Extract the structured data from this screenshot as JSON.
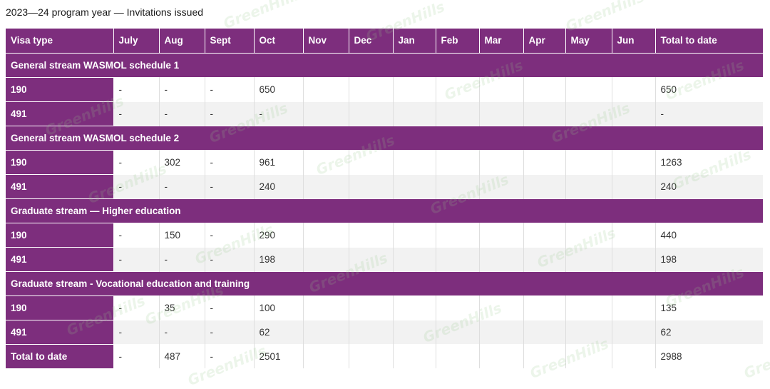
{
  "title": "2023—24 program year — Invitations issued",
  "watermark_text": "GreenHills",
  "colors": {
    "header_bg": "#7d2e7d",
    "header_text": "#ffffff",
    "row_alt_bg": "#f2f2f2",
    "row_bg": "#ffffff"
  },
  "table": {
    "columns": [
      "Visa type",
      "July",
      "Aug",
      "Sept",
      "Oct",
      "Nov",
      "Dec",
      "Jan",
      "Feb",
      "Mar",
      "Apr",
      "May",
      "Jun",
      "Total to date"
    ],
    "rows": [
      {
        "type": "section",
        "label": "General stream WASMOL schedule 1"
      },
      {
        "type": "data",
        "cells": [
          "190",
          "-",
          "-",
          "-",
          "650",
          "",
          "",
          "",
          "",
          "",
          "",
          "",
          "",
          "650"
        ]
      },
      {
        "type": "data",
        "cells": [
          "491",
          "-",
          "-",
          "-",
          "-",
          "",
          "",
          "",
          "",
          "",
          "",
          "",
          "",
          "-"
        ]
      },
      {
        "type": "section",
        "label": "General stream WASMOL schedule 2"
      },
      {
        "type": "data",
        "cells": [
          "190",
          "-",
          "302",
          "-",
          "961",
          "",
          "",
          "",
          "",
          "",
          "",
          "",
          "",
          "1263"
        ]
      },
      {
        "type": "data",
        "cells": [
          "491",
          "-",
          "-",
          "-",
          "240",
          "",
          "",
          "",
          "",
          "",
          "",
          "",
          "",
          "240"
        ]
      },
      {
        "type": "section",
        "label": "Graduate stream — Higher education"
      },
      {
        "type": "data",
        "cells": [
          "190",
          "-",
          "150",
          "-",
          "290",
          "",
          "",
          "",
          "",
          "",
          "",
          "",
          "",
          "440"
        ]
      },
      {
        "type": "data",
        "cells": [
          "491",
          "-",
          "-",
          "-",
          "198",
          "",
          "",
          "",
          "",
          "",
          "",
          "",
          "",
          "198"
        ]
      },
      {
        "type": "section",
        "label": "Graduate stream - Vocational education and training"
      },
      {
        "type": "data",
        "cells": [
          "190",
          "-",
          "35",
          "-",
          "100",
          "",
          "",
          "",
          "",
          "",
          "",
          "",
          "",
          "135"
        ]
      },
      {
        "type": "data",
        "cells": [
          "491",
          "-",
          "-",
          "-",
          "62",
          "",
          "",
          "",
          "",
          "",
          "",
          "",
          "",
          "62"
        ]
      },
      {
        "type": "data",
        "cells": [
          "Total to date",
          "-",
          "487",
          "-",
          "2501",
          "",
          "",
          "",
          "",
          "",
          "",
          "",
          "",
          "2988"
        ]
      }
    ]
  }
}
